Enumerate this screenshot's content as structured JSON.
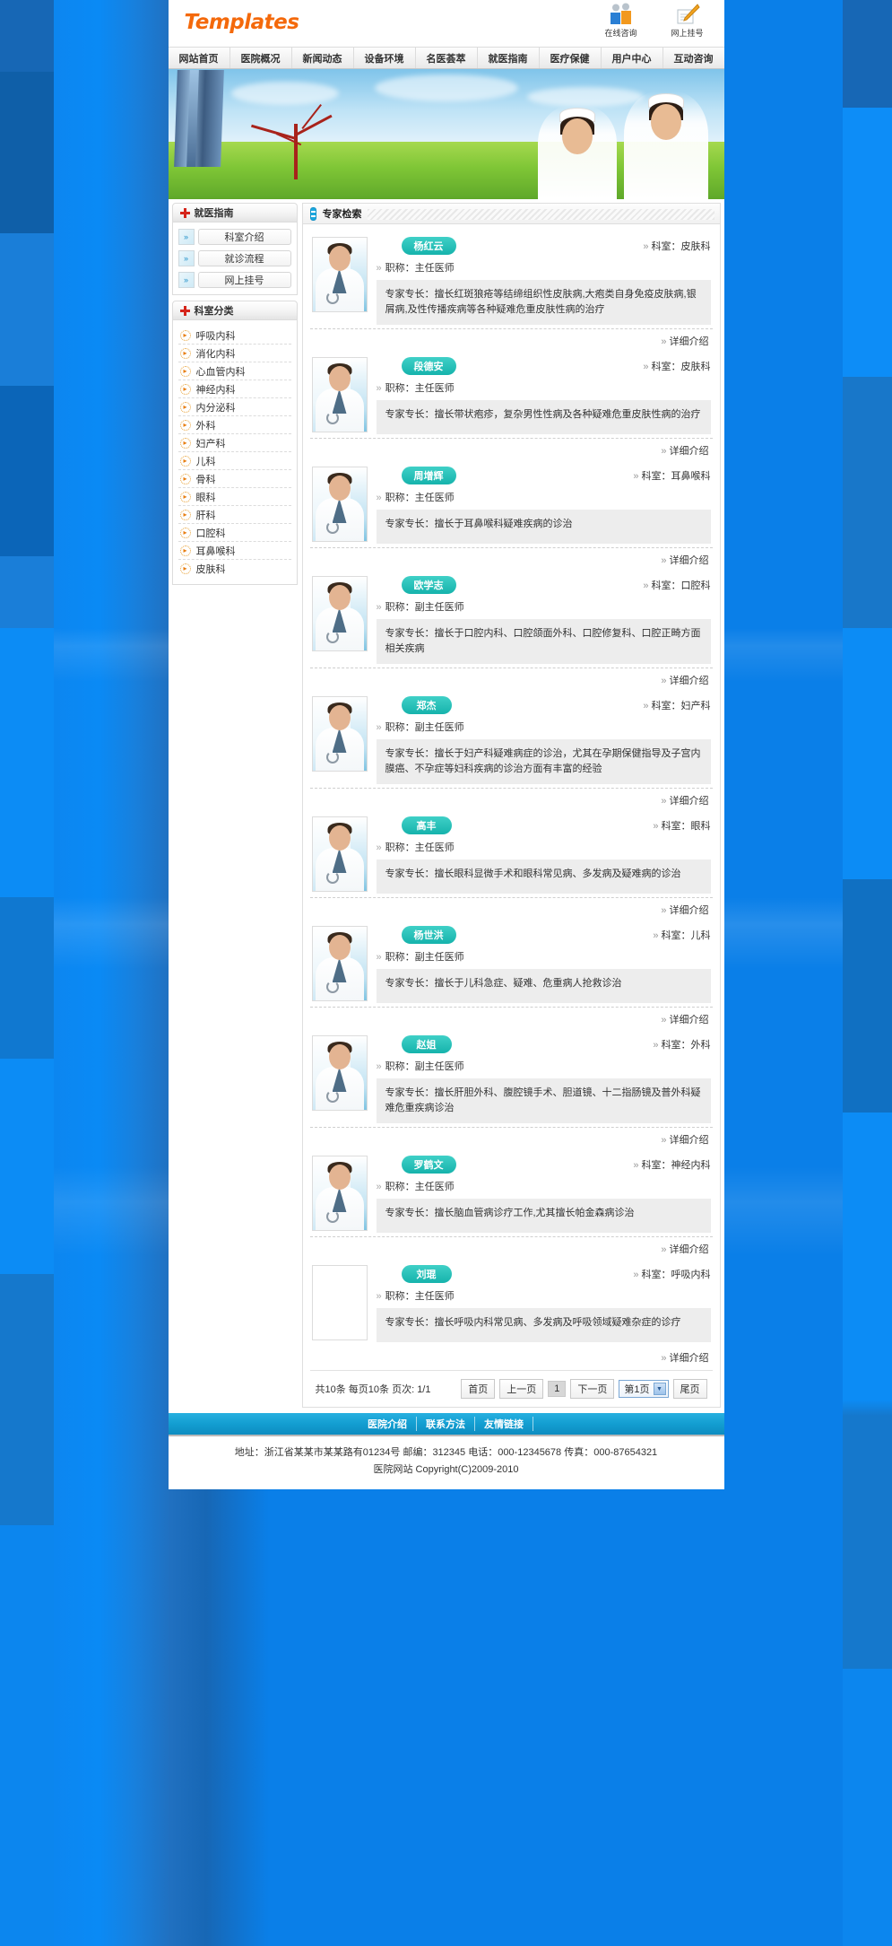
{
  "header": {
    "logo": "Templates",
    "top_icons": [
      {
        "name": "online-consult-icon",
        "label": "在线咨询"
      },
      {
        "name": "online-registration-icon",
        "label": "网上挂号"
      }
    ]
  },
  "nav": {
    "items": [
      "网站首页",
      "医院概况",
      "新闻动态",
      "设备环境",
      "名医荟萃",
      "就医指南",
      "医疗保健",
      "用户中心",
      "互动咨询"
    ]
  },
  "sidebar": {
    "guide": {
      "title": "就医指南",
      "items": [
        "科室介绍",
        "就诊流程",
        "网上挂号"
      ]
    },
    "depts": {
      "title": "科室分类",
      "items": [
        "呼吸内科",
        "消化内科",
        "心血管内科",
        "神经内科",
        "内分泌科",
        "外科",
        "妇产科",
        "儿科",
        "骨科",
        "眼科",
        "肝科",
        "口腔科",
        "耳鼻喉科",
        "皮肤科"
      ]
    }
  },
  "content": {
    "title": "专家检索",
    "detail_label": "详细介绍",
    "dept_prefix": "科室：",
    "title_prefix": "职称：",
    "experts": [
      {
        "name": "杨红云",
        "dept": "科室：皮肤科",
        "job_title": "职称：主任医师",
        "specialty": "专家专长：擅长红斑狼疮等结缔组织性皮肤病,大疱类自身免疫皮肤病,银屑病,及性传播疾病等各种疑难危重皮肤性病的治疗",
        "has_photo": true
      },
      {
        "name": "段德安",
        "dept": "科室：皮肤科",
        "job_title": "职称：主任医师",
        "specialty": "专家专长：擅长带状疱疹，复杂男性性病及各种疑难危重皮肤性病的治疗",
        "has_photo": true
      },
      {
        "name": "周增辉",
        "dept": "科室：耳鼻喉科",
        "job_title": "职称：主任医师",
        "specialty": "专家专长：擅长于耳鼻喉科疑难疾病的诊治",
        "has_photo": true
      },
      {
        "name": "欧学志",
        "dept": "科室：口腔科",
        "job_title": "职称：副主任医师",
        "specialty": "专家专长：擅长于口腔内科、口腔颌面外科、口腔修复科、口腔正畸方面相关疾病",
        "has_photo": true
      },
      {
        "name": "郑杰",
        "dept": "科室：妇产科",
        "job_title": "职称：副主任医师",
        "specialty": "专家专长：擅长于妇产科疑难病症的诊治，尤其在孕期保健指导及子宫内膜癌、不孕症等妇科疾病的诊治方面有丰富的经验",
        "has_photo": true
      },
      {
        "name": "高丰",
        "dept": "科室：眼科",
        "job_title": "职称：主任医师",
        "specialty": "专家专长：擅长眼科显微手术和眼科常见病、多发病及疑难病的诊治",
        "has_photo": true
      },
      {
        "name": "杨世洪",
        "dept": "科室：儿科",
        "job_title": "职称：副主任医师",
        "specialty": "专家专长：擅长于儿科急症、疑难、危重病人抢救诊治",
        "has_photo": true
      },
      {
        "name": "赵姐",
        "dept": "科室：外科",
        "job_title": "职称：副主任医师",
        "specialty": "专家专长：擅长肝胆外科、腹腔镜手术、胆道镜、十二指肠镜及普外科疑难危重疾病诊治",
        "has_photo": true
      },
      {
        "name": "罗鹤文",
        "dept": "科室：神经内科",
        "job_title": "职称：主任医师",
        "specialty": "专家专长：擅长脑血管病诊疗工作,尤其擅长帕金森病诊治",
        "has_photo": true
      },
      {
        "name": "刘琨",
        "dept": "科室：呼吸内科",
        "job_title": "职称：主任医师",
        "specialty": "专家专长：擅长呼吸内科常见病、多发病及呼吸领域疑难杂症的诊疗",
        "has_photo": false
      }
    ]
  },
  "pager": {
    "status": "共10条 每页10条 页次: 1/1",
    "first": "首页",
    "prev": "上一页",
    "current": "1",
    "next": "下一页",
    "select_value": "第1页",
    "last": "尾页"
  },
  "footer": {
    "links": [
      "医院介绍",
      "联系方法",
      "友情链接"
    ],
    "address_line": "地址：浙江省某某市某某路有01234号 邮编：312345 电话：000-12345678 传真：000-87654321",
    "copyright": "医院网站 Copyright(C)2009-2010"
  },
  "colors": {
    "accent_blue": "#0a7fe8",
    "logo_orange": "#f4690b",
    "pill_teal": "#16b3ac",
    "footer_cyan": "#139ed1",
    "cross_red": "#d5241a"
  }
}
